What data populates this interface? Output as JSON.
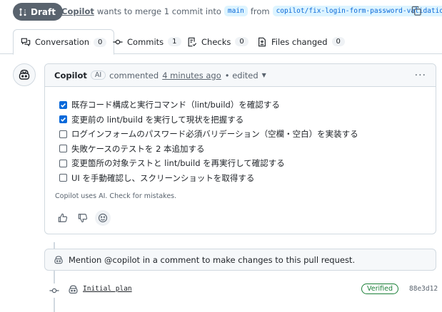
{
  "header": {
    "draft_label": "Draft",
    "author": "Copilot",
    "action_text": "wants to merge 1 commit into",
    "base_branch": "main",
    "from_text": "from",
    "head_branch": "copilot/fix-login-form-password-validation"
  },
  "tabs": [
    {
      "label": "Conversation",
      "count": "0",
      "icon": "comment-discussion-icon"
    },
    {
      "label": "Commits",
      "count": "1",
      "icon": "git-commit-icon"
    },
    {
      "label": "Checks",
      "count": "0",
      "icon": "checklist-icon"
    },
    {
      "label": "Files changed",
      "count": "0",
      "icon": "file-diff-icon"
    }
  ],
  "comment": {
    "author": "Copilot",
    "badge": "AI",
    "verb": "commented",
    "time": "4 minutes ago",
    "edited": "• edited",
    "tasks": [
      {
        "text": "既存コード構成と実行コマンド（lint/build）を確認する",
        "checked": true
      },
      {
        "text": "変更前の lint/build を実行して現状を把握する",
        "checked": true
      },
      {
        "text": "ログインフォームのパスワード必須バリデーション（空欄・空白）を実装する",
        "checked": false
      },
      {
        "text": "失敗ケースのテストを 2 本追加する",
        "checked": false
      },
      {
        "text": "変更箇所の対象テストと lint/build を再実行して確認する",
        "checked": false
      },
      {
        "text": "UI を手動確認し、スクリーンショットを取得する",
        "checked": false
      }
    ],
    "disclaimer": "Copilot uses AI. Check for mistakes."
  },
  "mention_note": "Mention @copilot in a comment to make changes to this pull request.",
  "commit": {
    "message": "Initial plan",
    "verified": "Verified",
    "sha": "88e3d12"
  },
  "colors": {
    "accent": "#0969da",
    "draft_bg": "#59636e",
    "verified": "#1a7f37",
    "border": "#d1d9e0"
  }
}
